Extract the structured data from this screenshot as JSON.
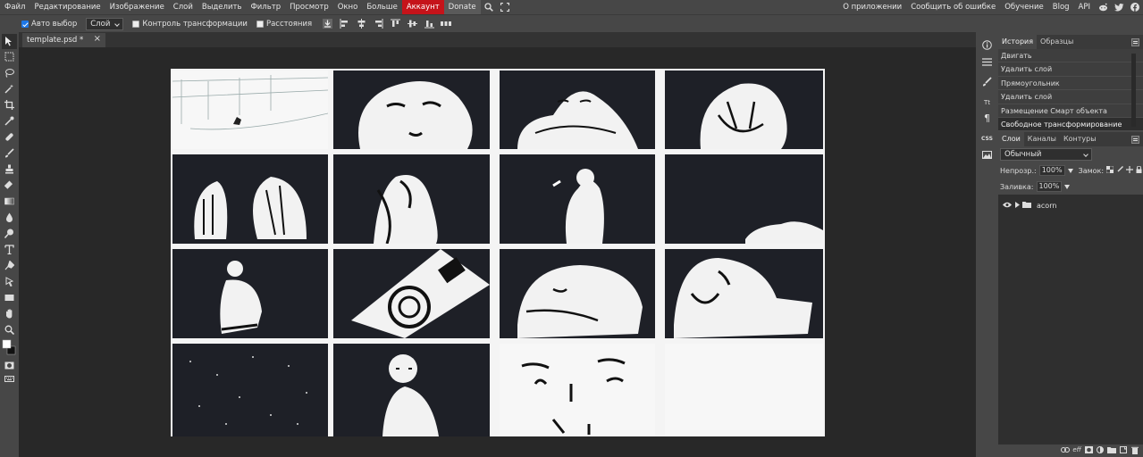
{
  "menu": {
    "items": [
      "Файл",
      "Редактирование",
      "Изображение",
      "Слой",
      "Выделить",
      "Фильтр",
      "Просмотр",
      "Окно",
      "Больше"
    ],
    "account": "Аккаунт",
    "donate": "Donate",
    "right_items": [
      "О приложении",
      "Сообщить об ошибке",
      "Обучение",
      "Blog",
      "API"
    ]
  },
  "options": {
    "auto_select": "Авто выбор",
    "auto_select_checked": true,
    "select_value": "Слой",
    "transform_controls": "Контроль трансформации",
    "distances": "Расстояния"
  },
  "tabs": {
    "document": "template.psd *",
    "close": "×"
  },
  "history": {
    "tabs": [
      "История",
      "Образцы"
    ],
    "items": [
      "Двигать",
      "Удалить слой",
      "Прямоугольник",
      "Удалить слой",
      "Размещение Смарт объекта",
      "Свободное трансформирование"
    ],
    "active_index": 5
  },
  "layers": {
    "tabs": [
      "Слои",
      "Каналы",
      "Контуры"
    ],
    "blend_mode": "Обычный",
    "opacity_label": "Непрозр.:",
    "opacity_value": "100%",
    "lock_label": "Замок:",
    "fill_label": "Заливка:",
    "fill_value": "100%",
    "items": [
      {
        "name": "acorn",
        "type": "folder",
        "visible": true
      }
    ]
  },
  "icons": {
    "right_column": [
      "info-icon",
      "adjust-icon",
      "brush-settings-icon",
      "character-icon",
      "paragraph-icon",
      "css-icon",
      "image-icon"
    ],
    "css_label": "CSS",
    "char_label": "Tt",
    "para_label": "¶"
  },
  "colors": {
    "chrome": "#474747",
    "canvas_bg": "#282828",
    "account": "#c5131a",
    "accent": "#1d77e8"
  }
}
